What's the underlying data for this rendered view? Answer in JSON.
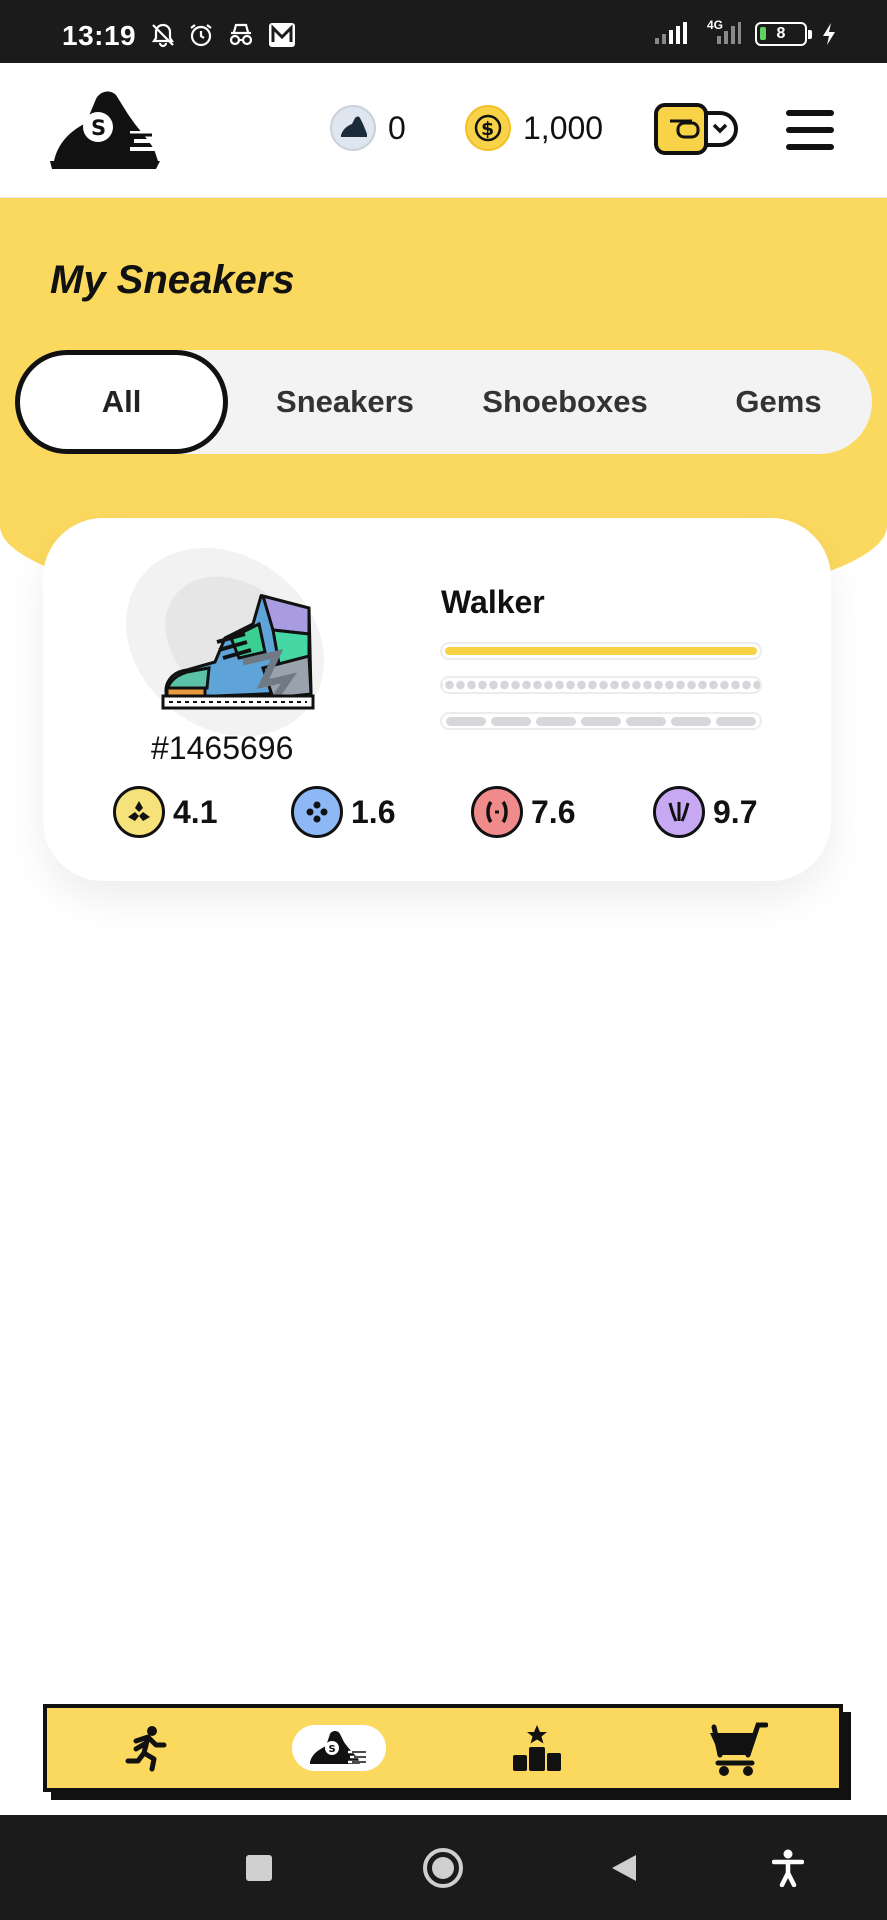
{
  "status_bar": {
    "time": "13:19",
    "network": "4G",
    "battery": "8",
    "icons": [
      "bell-off-icon",
      "alarm-icon",
      "incognito-icon",
      "m-app-icon",
      "signal-icon",
      "signal-icon",
      "battery-icon",
      "charging-icon"
    ]
  },
  "header": {
    "energy_count": "0",
    "gold_count": "1,000",
    "icons": [
      "app-logo",
      "energy-sneaker-icon",
      "gold-coin-icon",
      "wallet-icon",
      "menu-icon"
    ]
  },
  "page": {
    "title": "My Sneakers"
  },
  "tabs": [
    {
      "label": "All",
      "active": true
    },
    {
      "label": "Sneakers",
      "active": false
    },
    {
      "label": "Shoeboxes",
      "active": false
    },
    {
      "label": "Gems",
      "active": false
    }
  ],
  "sneaker_card": {
    "name": "Walker",
    "id": "#1465696",
    "level_bar_fraction": 1.0,
    "stats": [
      {
        "icon": "efficiency-icon",
        "value": "4.1",
        "color": "#f6e27a"
      },
      {
        "icon": "luck-icon",
        "value": "1.6",
        "color": "#8db8f5"
      },
      {
        "icon": "comfort-icon",
        "value": "7.6",
        "color": "#f08b8b"
      },
      {
        "icon": "resilience-icon",
        "value": "9.7",
        "color": "#c7a8f2"
      }
    ]
  },
  "bottom_nav": {
    "items": [
      "run-icon",
      "sneakers-icon",
      "leaderboard-icon",
      "cart-icon"
    ],
    "active": "sneakers-icon"
  },
  "system_nav": [
    "recents-button",
    "home-button",
    "back-button",
    "accessibility-button"
  ],
  "colors": {
    "accent_yellow": "#fbd95f",
    "dark": "#111111",
    "status_bar": "#1b1b1b"
  }
}
